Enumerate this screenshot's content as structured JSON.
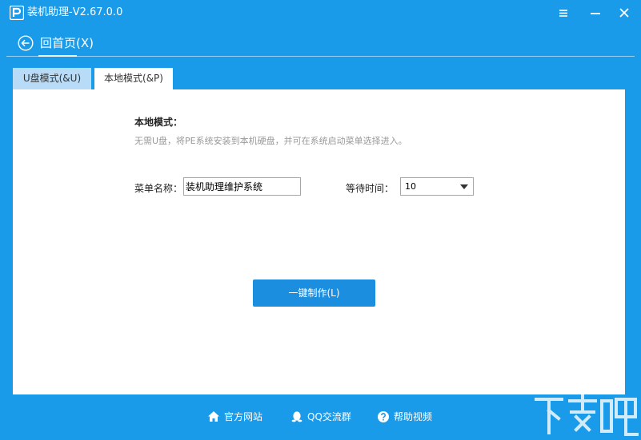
{
  "window": {
    "title": "装机助理-V2.67.0.0",
    "controls": [
      "menu",
      "minimize",
      "close"
    ]
  },
  "header": {
    "back_label": "回首页(X)"
  },
  "tabs": [
    {
      "label": "U盘模式(&U)",
      "selected": false
    },
    {
      "label": "本地模式(&P)",
      "selected": true
    }
  ],
  "content": {
    "section_title": "本地模式：",
    "description": "无需U盘，将PE系统安装到本机硬盘，并可在系统启动菜单选择进入。",
    "menu_name": {
      "label": "菜单名称：",
      "value": "装机助理维护系统"
    },
    "wait_time": {
      "label": "等待时间：",
      "value": "10"
    },
    "make_button": "一键制作(L)"
  },
  "footer": {
    "links": [
      {
        "label": "官方网站",
        "icon": "home-icon"
      },
      {
        "label": "QQ交流群",
        "icon": "qq-icon"
      },
      {
        "label": "帮助视频",
        "icon": "help-icon"
      }
    ]
  },
  "colors": {
    "window_bg": "#1a9be9",
    "tab_inactive": "#b8dcf8",
    "button": "#1c8ee0",
    "description_text": "#999999"
  }
}
